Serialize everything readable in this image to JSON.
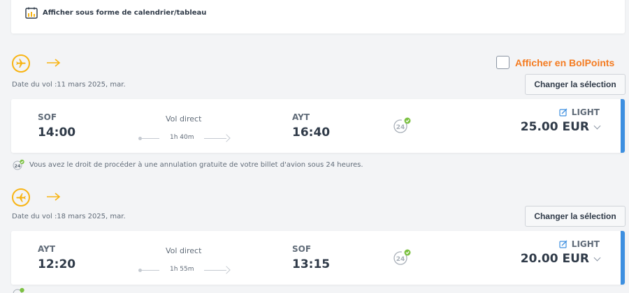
{
  "calendar_link": {
    "label": "Afficher sous forme de calendrier/tableau",
    "icon": "calendar-chart-icon"
  },
  "bolpoints_toggle": {
    "label": "Afficher en BolPoints",
    "checked": false
  },
  "colors": {
    "accent_orange": "#f47b20",
    "icon_yellow": "#f8b414",
    "selected_blue": "#3d8fe0",
    "badge_green": "#7cc142"
  },
  "flights": [
    {
      "direction": "outbound",
      "direction_icon": "plane-departure-icon",
      "date_label": "Date du vol :11 mars 2025, mar.",
      "change_label": "Changer la sélection",
      "from_code": "SOF",
      "from_time": "14:00",
      "flight_type": "Vol direct",
      "duration": "1h 40m",
      "to_code": "AYT",
      "to_time": "16:40",
      "fare_class": "LIGHT",
      "price": "25.00 EUR",
      "cancel_note": "Vous avez le droit de procéder à une annulation gratuite de votre billet d'avion sous 24 heures."
    },
    {
      "direction": "return",
      "direction_icon": "plane-return-icon",
      "date_label": "Date du vol :18 mars 2025, mar.",
      "change_label": "Changer la sélection",
      "from_code": "AYT",
      "from_time": "12:20",
      "flight_type": "Vol direct",
      "duration": "1h 55m",
      "to_code": "SOF",
      "to_time": "13:15",
      "fare_class": "LIGHT",
      "price": "20.00 EUR"
    }
  ]
}
